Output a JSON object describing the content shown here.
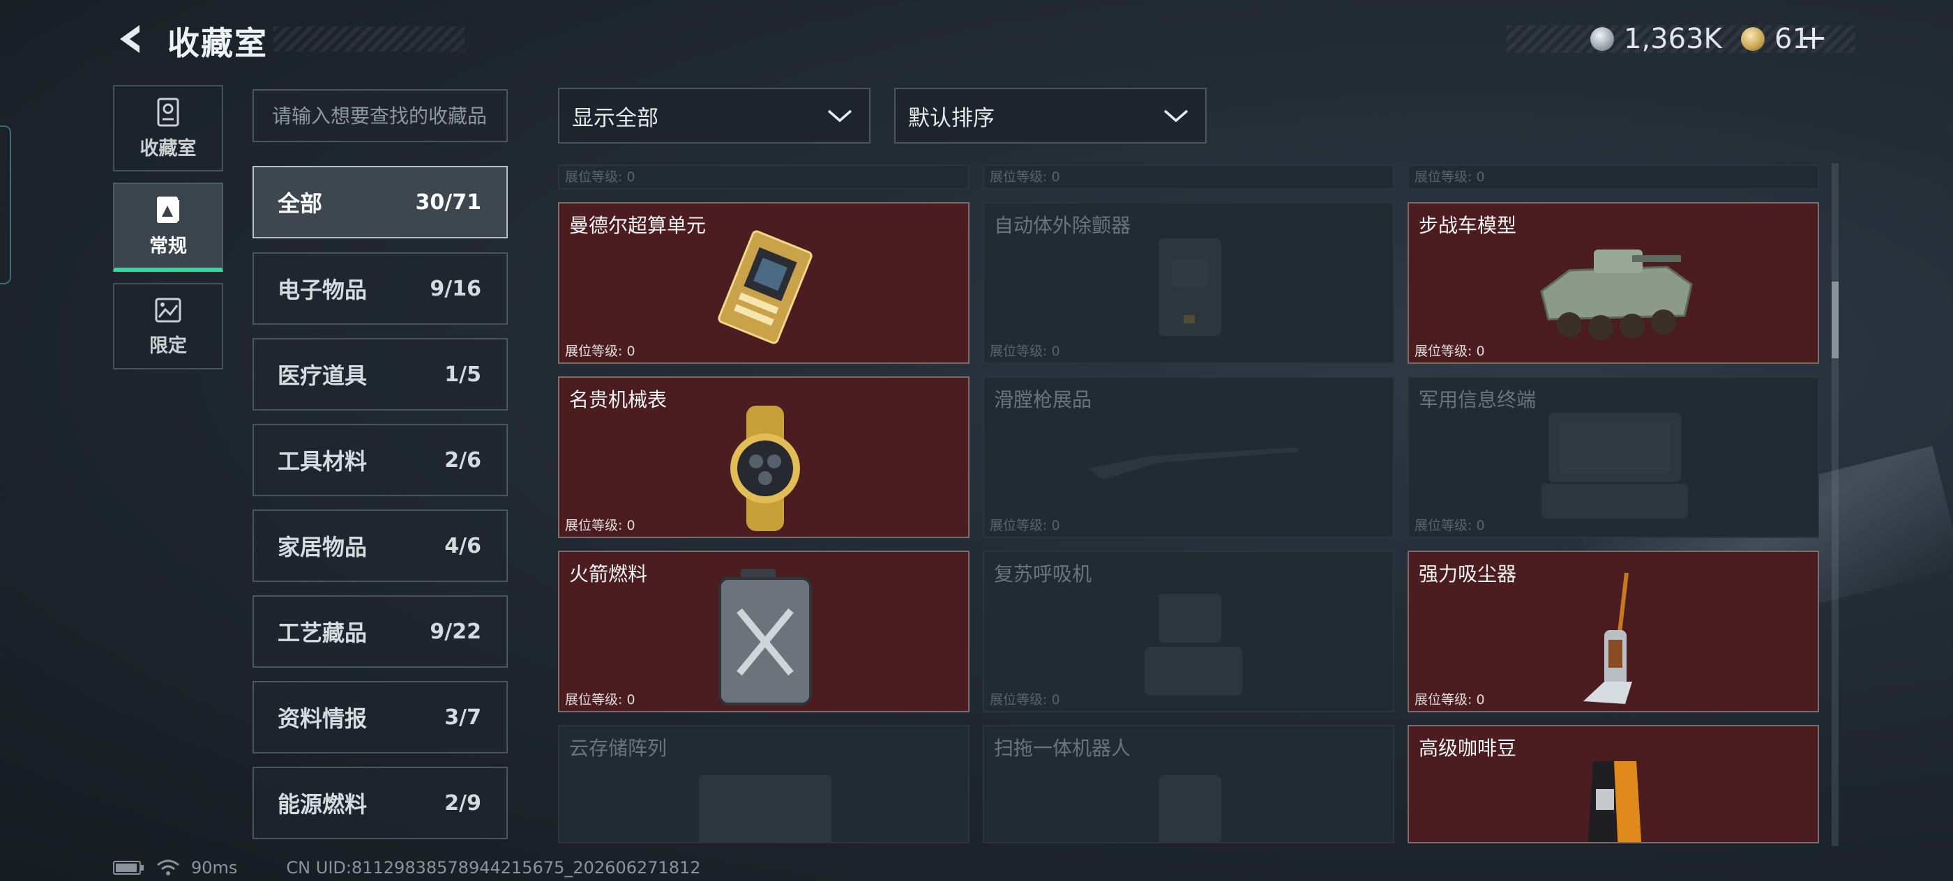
{
  "header": {
    "back_icon": "back-arrow-icon",
    "title": "收藏室",
    "currencies": [
      {
        "icon": "silver-coin-icon",
        "value": "1,363K"
      },
      {
        "icon": "gold-coin-icon",
        "value": "61"
      }
    ],
    "add_label": "+"
  },
  "side_nav": [
    {
      "label": "收藏室",
      "icon": "collection-room-icon",
      "active": false
    },
    {
      "label": "常规",
      "icon": "regular-card-icon",
      "active": true
    },
    {
      "label": "限定",
      "icon": "limited-image-icon",
      "active": false
    }
  ],
  "search": {
    "placeholder": "请输入想要查找的收藏品",
    "value": ""
  },
  "filters": {
    "display": {
      "value": "显示全部",
      "icon": "chevron-down-icon"
    },
    "sort": {
      "value": "默认排序",
      "icon": "chevron-down-icon"
    }
  },
  "categories": [
    {
      "name": "全部",
      "count": "30/71",
      "active": true
    },
    {
      "name": "电子物品",
      "count": "9/16"
    },
    {
      "name": "医疗道具",
      "count": "1/5"
    },
    {
      "name": "工具材料",
      "count": "2/6"
    },
    {
      "name": "家居物品",
      "count": "4/6"
    },
    {
      "name": "工艺藏品",
      "count": "9/22"
    },
    {
      "name": "资料情报",
      "count": "3/7"
    },
    {
      "name": "能源燃料",
      "count": "2/9"
    }
  ],
  "grid": {
    "level_label": "展位等级: 0",
    "items": [
      {
        "name": "",
        "owned": false,
        "art": "none"
      },
      {
        "name": "",
        "owned": false,
        "art": "none"
      },
      {
        "name": "",
        "owned": false,
        "art": "none"
      },
      {
        "name": "曼德尔超算单元",
        "owned": true,
        "art": "computer-unit-icon"
      },
      {
        "name": "自动体外除颤器",
        "owned": false,
        "art": "defibrillator-icon"
      },
      {
        "name": "步战车模型",
        "owned": true,
        "art": "ifv-model-icon"
      },
      {
        "name": "名贵机械表",
        "owned": true,
        "art": "gold-watch-icon"
      },
      {
        "name": "滑膛枪展品",
        "owned": false,
        "art": "musket-icon"
      },
      {
        "name": "军用信息终端",
        "owned": false,
        "art": "military-terminal-icon"
      },
      {
        "name": "火箭燃料",
        "owned": true,
        "art": "fuel-canister-icon"
      },
      {
        "name": "复苏呼吸机",
        "owned": false,
        "art": "ventilator-icon"
      },
      {
        "name": "强力吸尘器",
        "owned": true,
        "art": "vacuum-cleaner-icon"
      },
      {
        "name": "云存储阵列",
        "owned": false,
        "art": "storage-array-icon"
      },
      {
        "name": "扫拖一体机器人",
        "owned": false,
        "art": "robot-vacuum-icon"
      },
      {
        "name": "高级咖啡豆",
        "owned": true,
        "art": "coffee-bag-icon"
      }
    ]
  },
  "footer": {
    "battery_icon": "battery-icon",
    "wifi_icon": "wifi-icon",
    "ping": "90ms",
    "uid": "CN UID:81129838578944215675_202606271812"
  }
}
